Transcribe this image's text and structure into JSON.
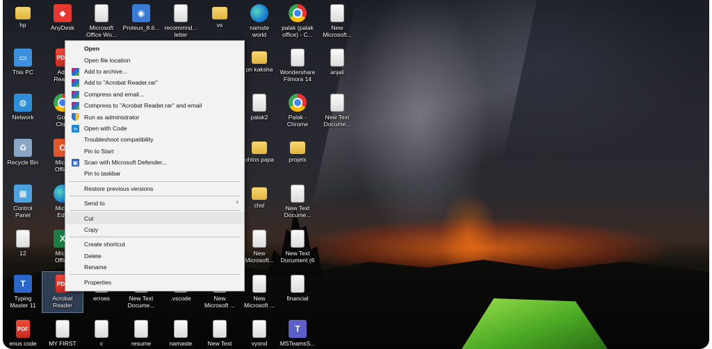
{
  "desktop": {
    "icons": [
      {
        "name": "hp",
        "kind": "folder",
        "label": "hp"
      },
      {
        "name": "anydesk",
        "kind": "app",
        "label": "AnyDesk",
        "color": "#e8372f",
        "glyph": "◆"
      },
      {
        "name": "microsoft-office-word",
        "kind": "doc",
        "label": "Microsoft\nOffice Wo..."
      },
      {
        "name": "proteus",
        "kind": "app",
        "label": "Proteus_8.6...",
        "color": "#3a7bd5",
        "glyph": "◉"
      },
      {
        "name": "recommnd-letter",
        "kind": "doc",
        "label": "recommnd...\nletter"
      },
      {
        "name": "vs",
        "kind": "folder",
        "label": "vs"
      },
      {
        "name": "namste-world",
        "kind": "edge",
        "label": "namste\nworld"
      },
      {
        "name": "palak-office",
        "kind": "chrome",
        "label": "palak (palak\noffice) - C..."
      },
      {
        "name": "new-microsoft-top",
        "kind": "doc",
        "label": "New\nMicrosoft..."
      },
      {
        "name": "this-pc",
        "kind": "app",
        "label": "This PC",
        "color": "#3d8fe0",
        "glyph": "▭"
      },
      {
        "name": "adobe-reader-partial",
        "kind": "pdf",
        "label": "Ado\nReade"
      },
      {
        "name": "pn-kaksha",
        "kind": "folder",
        "label": "pn kaksha"
      },
      {
        "name": "wondershare-filmora",
        "kind": "doc",
        "label": "Wondershare\nFilmora 14"
      },
      {
        "name": "anjali",
        "kind": "doc",
        "label": "anjali"
      },
      {
        "name": "network",
        "kind": "app",
        "label": "Network",
        "color": "#2e8fd8",
        "glyph": "◍"
      },
      {
        "name": "google-chrome-partial",
        "kind": "chrome",
        "label": "Goo\nChro"
      },
      {
        "name": "palak2",
        "kind": "doc",
        "label": "palak2"
      },
      {
        "name": "palak-chrome",
        "kind": "chrome",
        "label": "Palak -\nChrome"
      },
      {
        "name": "new-text-document-1",
        "kind": "doc",
        "label": "New Text\nDocume..."
      },
      {
        "name": "recycle-bin",
        "kind": "app",
        "label": "Recycle Bin",
        "color": "#8aa6c6",
        "glyph": "♻"
      },
      {
        "name": "microsoft-office-partial",
        "kind": "app",
        "label": "Micro\nOffice",
        "color": "#e4572e",
        "glyph": "O"
      },
      {
        "name": "photos-papa",
        "kind": "folder",
        "label": "ohtos papa"
      },
      {
        "name": "projets",
        "kind": "folder",
        "label": "projets"
      },
      {
        "name": "control-panel",
        "kind": "app",
        "label": "Control\nPanel",
        "color": "#4aa3df",
        "glyph": "▦"
      },
      {
        "name": "microsoft-edge-partial",
        "kind": "edge",
        "label": "Micro\nEdg"
      },
      {
        "name": "chsl",
        "kind": "folder",
        "label": "chsl"
      },
      {
        "name": "new-text-document-2",
        "kind": "doc",
        "label": "New Text\nDocume..."
      },
      {
        "name": "twelve",
        "kind": "doc",
        "label": "12"
      },
      {
        "name": "microsoft-office-excel-partial",
        "kind": "app",
        "label": "Micro\nOffice",
        "color": "#1e7d45",
        "glyph": "X"
      },
      {
        "name": "new-microsoft-mid",
        "kind": "doc",
        "label": "New\nMicrosoft..."
      },
      {
        "name": "new-text-document-6",
        "kind": "doc",
        "label": "New Text\nDocument (6"
      },
      {
        "name": "typing-master",
        "kind": "app",
        "label": "Typing\nMaster 11",
        "color": "#2a67c9",
        "glyph": "T"
      },
      {
        "name": "acrobat-reader",
        "kind": "pdf",
        "label": "Acrobat\nReader"
      },
      {
        "name": "erroes",
        "kind": "doc",
        "label": "erroes"
      },
      {
        "name": "new-text-document-bottom",
        "kind": "doc",
        "label": "New Text\nDocume..."
      },
      {
        "name": "vscode-file",
        "kind": "doc",
        "label": ".vscode"
      },
      {
        "name": "new-microsoft-bottom-1",
        "kind": "doc",
        "label": "New\nMicrosoft ..."
      },
      {
        "name": "new-microsoft-bottom-2",
        "kind": "doc",
        "label": "New\nMicrosoft ..."
      },
      {
        "name": "financial",
        "kind": "doc",
        "label": "financial"
      },
      {
        "name": "enus-code",
        "kind": "pdf",
        "label": "enus code"
      },
      {
        "name": "my-first",
        "kind": "doc",
        "label": "MY FIRST"
      },
      {
        "name": "c-file",
        "kind": "doc",
        "label": "c"
      },
      {
        "name": "resume",
        "kind": "doc",
        "label": "resume"
      },
      {
        "name": "namaste",
        "kind": "doc",
        "label": "namaste"
      },
      {
        "name": "new-text-last",
        "kind": "doc",
        "label": "New Text"
      },
      {
        "name": "vyond",
        "kind": "doc",
        "label": "vyond"
      },
      {
        "name": "msteams",
        "kind": "app",
        "label": "MSTeamsS...",
        "color": "#5b5fc7",
        "glyph": "T"
      }
    ]
  },
  "context_menu": {
    "items": [
      {
        "type": "item",
        "name": "open",
        "label": "Open",
        "bold": true,
        "icon": null
      },
      {
        "type": "item",
        "name": "open-file-location",
        "label": "Open file location",
        "icon": null
      },
      {
        "type": "item",
        "name": "add-to-archive",
        "label": "Add to archive...",
        "icon": "winrar-icon"
      },
      {
        "type": "item",
        "name": "add-to-rar",
        "label": "Add to \"Acrobat Reader.rar\"",
        "icon": "winrar-icon"
      },
      {
        "type": "item",
        "name": "compress-and-email",
        "label": "Compress and email...",
        "icon": "winrar-icon"
      },
      {
        "type": "item",
        "name": "compress-rar-email",
        "label": "Compress to \"Acrobat Reader.rar\" and email",
        "icon": "winrar-icon"
      },
      {
        "type": "item",
        "name": "run-as-administrator",
        "label": "Run as administrator",
        "icon": "uac-shield-icon"
      },
      {
        "type": "item",
        "name": "open-with-code",
        "label": "Open with Code",
        "icon": "vscode-icon"
      },
      {
        "type": "item",
        "name": "troubleshoot-compatibility",
        "label": "Troubleshoot compatibility",
        "icon": null
      },
      {
        "type": "item",
        "name": "pin-to-start",
        "label": "Pin to Start",
        "icon": null
      },
      {
        "type": "item",
        "name": "scan-with-defender",
        "label": "Scan with Microsoft Defender...",
        "icon": "defender-icon"
      },
      {
        "type": "item",
        "name": "pin-to-taskbar",
        "label": "Pin to taskbar",
        "icon": null
      },
      {
        "type": "sep"
      },
      {
        "type": "item",
        "name": "restore-previous-versions",
        "label": "Restore previous versions",
        "icon": null
      },
      {
        "type": "sep"
      },
      {
        "type": "item",
        "name": "send-to",
        "label": "Send to",
        "icon": null,
        "submenu": true
      },
      {
        "type": "sep"
      },
      {
        "type": "item",
        "name": "cut",
        "label": "Cut",
        "icon": null,
        "highlighted": true
      },
      {
        "type": "item",
        "name": "copy",
        "label": "Copy",
        "icon": null
      },
      {
        "type": "sep"
      },
      {
        "type": "item",
        "name": "create-shortcut",
        "label": "Create shortcut",
        "icon": null
      },
      {
        "type": "item",
        "name": "delete",
        "label": "Delete",
        "icon": null
      },
      {
        "type": "item",
        "name": "rename",
        "label": "Rename",
        "icon": null
      },
      {
        "type": "sep"
      },
      {
        "type": "item",
        "name": "properties",
        "label": "Properties",
        "icon": null
      }
    ],
    "submenu_arrow": "›"
  },
  "colors": {
    "menu_bg": "#f2f2f2",
    "menu_highlight": "#e6e6e6",
    "selection": "#78a0dc"
  }
}
